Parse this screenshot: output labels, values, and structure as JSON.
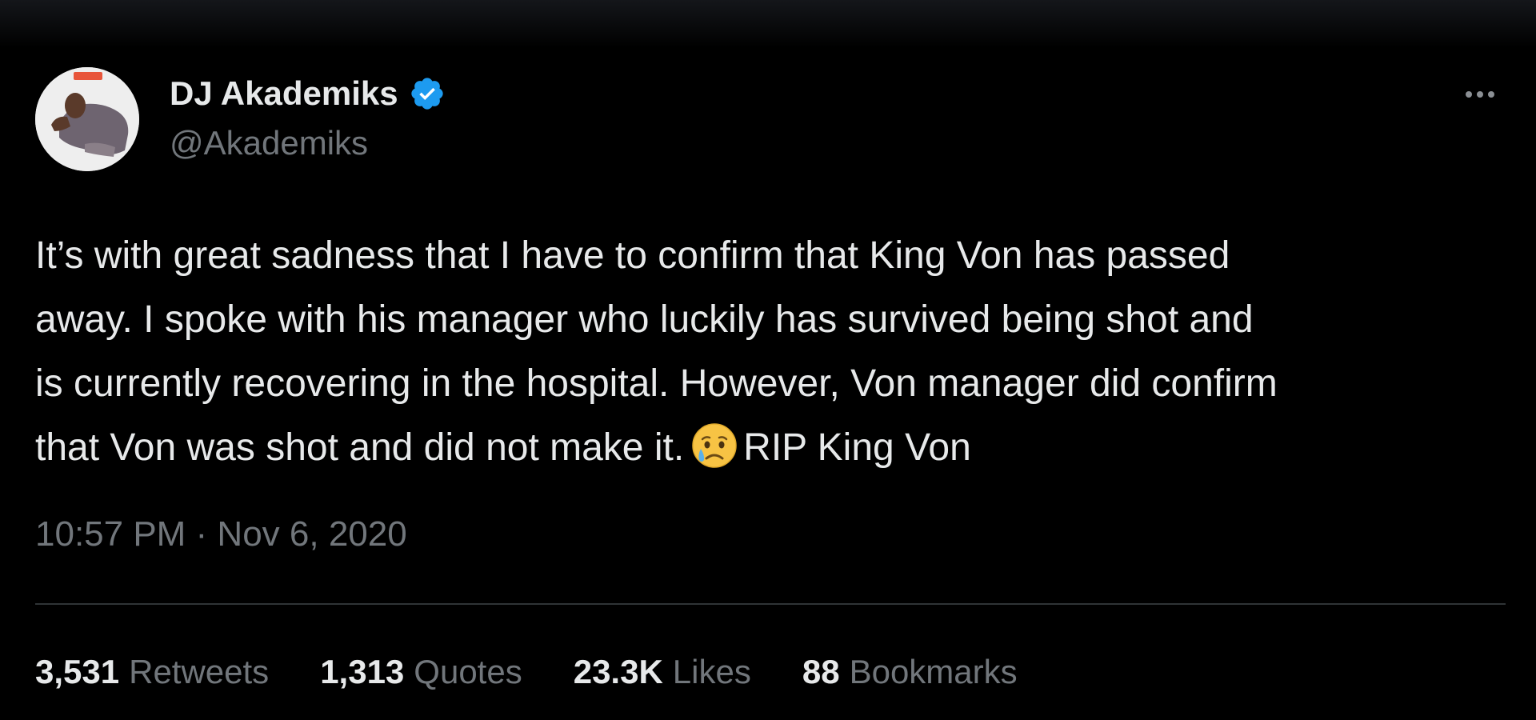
{
  "author": {
    "display_name": "DJ Akademiks",
    "handle": "@Akademiks",
    "verified": true,
    "verified_color": "#1d9bf0"
  },
  "tweet": {
    "lines": [
      "It’s with great sadness that I have to confirm that King Von has passed",
      "away. I spoke with his manager who luckily has survived being shot and",
      "is currently recovering in the hospital. However, Von manager did confirm",
      "that Von was shot and did not make it."
    ],
    "emoji": "crying-face-emoji",
    "after_emoji": "RIP King Von"
  },
  "timestamp": "10:57 PM · Nov 6, 2020",
  "stats": [
    {
      "count": "3,531",
      "label": "Retweets"
    },
    {
      "count": "1,313",
      "label": "Quotes"
    },
    {
      "count": "23.3K",
      "label": "Likes"
    },
    {
      "count": "88",
      "label": "Bookmarks"
    }
  ],
  "colors": {
    "background": "#000000",
    "primary_text": "#e7e9ea",
    "secondary_text": "#71767b",
    "divider": "#2f3336"
  }
}
